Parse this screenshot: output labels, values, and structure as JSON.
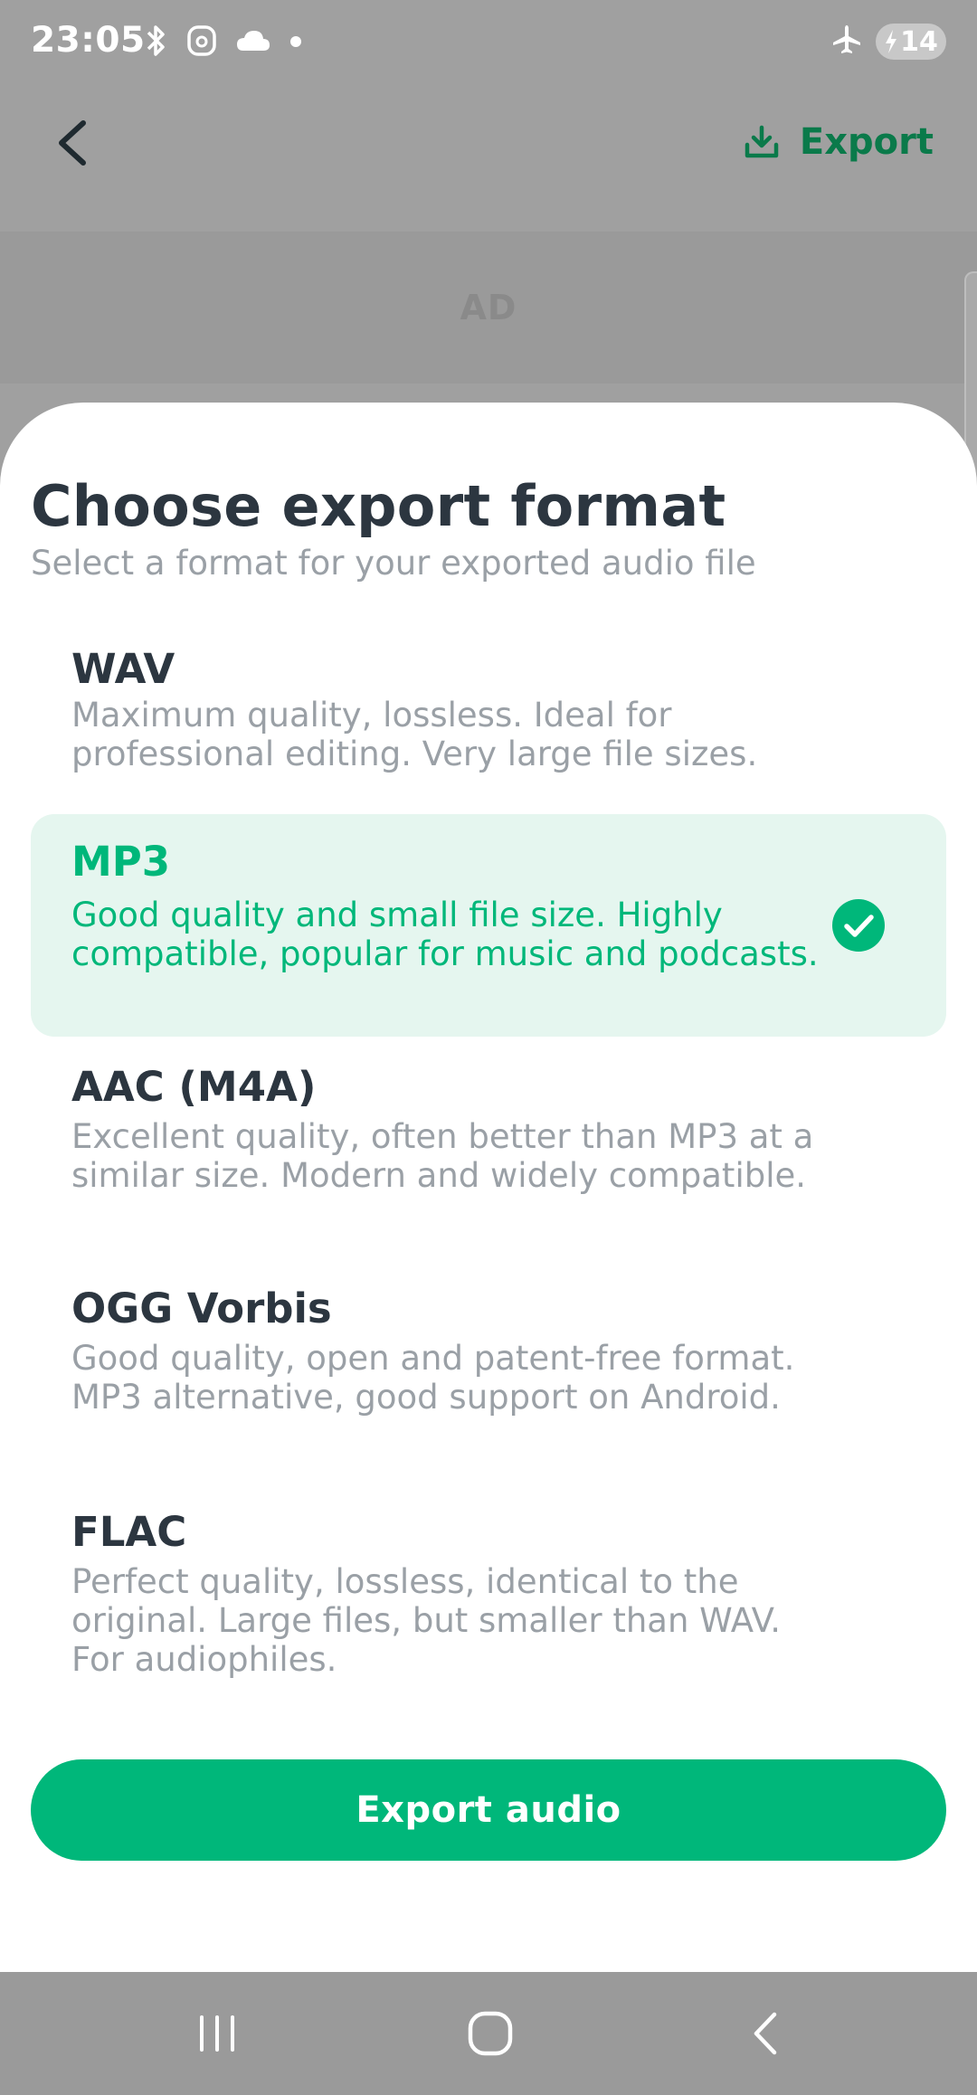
{
  "status_bar": {
    "time": "23:05",
    "battery_level": "14",
    "icons": [
      "bluetooth-icon",
      "threads-icon",
      "cloud-icon",
      "dot-icon",
      "airplane-mode-icon",
      "battery-charging-icon"
    ]
  },
  "app_bar": {
    "export_label": "Export"
  },
  "ad": {
    "label": "AD"
  },
  "sheet": {
    "title": "Choose export format",
    "subtitle": "Select a format for your exported audio file",
    "selected_index": 1,
    "options": [
      {
        "name": "WAV",
        "description": "Maximum quality, lossless. Ideal for professional editing. Very large file sizes."
      },
      {
        "name": "MP3",
        "description": "Good quality and small file size. Highly compatible, popular for music and podcasts."
      },
      {
        "name": "AAC (M4A)",
        "description": "Excellent quality, often better than MP3 at a similar size. Modern and widely compatible."
      },
      {
        "name": "OGG Vorbis",
        "description": "Good quality, open and patent-free format. MP3 alternative, good support on Android."
      },
      {
        "name": "FLAC",
        "description": "Perfect quality, lossless, identical to the original. Large files, but smaller than WAV. For audiophiles."
      }
    ],
    "export_button_label": "Export audio"
  },
  "colors": {
    "accent": "#00b77a",
    "accent_dark": "#0a7a4a",
    "selected_bg": "#e5f6ef",
    "title_text": "#2c3640",
    "muted_text": "#9aa0a6"
  }
}
